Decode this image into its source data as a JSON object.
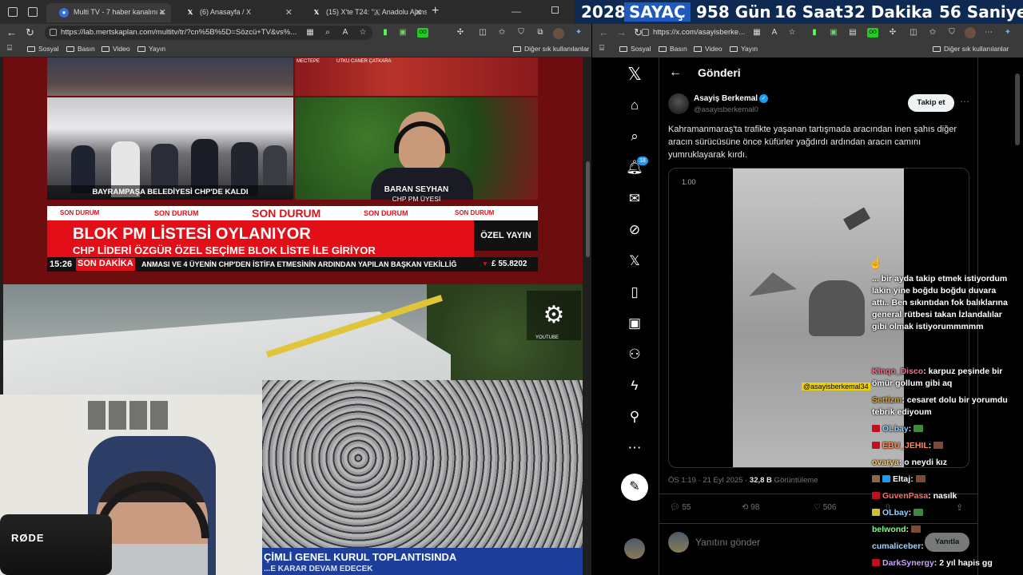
{
  "left_browser": {
    "tabs": [
      {
        "title": "Multi TV - 7 haber kanalını a"
      },
      {
        "title": "(6) Anasayfa / X"
      },
      {
        "title": "(15) X'te T24: \"🇦 Anadolu Ajansı"
      }
    ],
    "url": "https://lab.mertskaplan.com/multitv/tr/?cn%5B%5D=Sözcü+TV&vs%...",
    "bookmarks": [
      "Sosyal",
      "Basın",
      "Video",
      "Yayın"
    ],
    "other_bookmarks": "Diğer sık kullanılanlar"
  },
  "tv": {
    "caption_left": "BAYRAMPAŞA BELEDİYESİ CHP'DE KALDI",
    "guest_name": "BARAN SEYHAN",
    "guest_title": "CHP PM ÜYESİ",
    "son_durum": "SON DURUM",
    "headline": "BLOK PM LİSTESİ OYLANIYOR",
    "subheadline": "CHP LİDERİ ÖZGÜR ÖZEL SEÇİME BLOK LİSTE İLE GİRİYOR",
    "ozel_yayin": "ÖZEL YAYIN",
    "time": "15:26",
    "son_dakika": "SON DAKİKA",
    "ticker": "ANMASI VE 4 ÜYENİN CHP'DEN İSTİFA ETMESİNİN ARDINDAN YAPILAN BAŞKAN VEKİLLİĞ",
    "currency": "£ 55.8202",
    "stand_label_1": "UTKU CANER ÇATKARA",
    "stand_label_2": "MECTEPE"
  },
  "live": {
    "lower_third": "ÇİMLİ GENEL KURUL TOPLANTISINDA",
    "lower_third_2": "...E KARAR DEVAM EDECEK",
    "corner_text": "YOUTUBE"
  },
  "webcam": {
    "mic_brand": "RØDE"
  },
  "countdown": {
    "year": "2028",
    "label": "SAYAÇ",
    "days": "958 Gün",
    "hours": "16 Saat",
    "minutes": "32 Dakika",
    "seconds": "56 Saniye"
  },
  "right_browser": {
    "url": "https://x.com/asayisberke...",
    "bookmarks": [
      "Sosyal",
      "Basın",
      "Video",
      "Yayın"
    ],
    "other_bookmarks": "Diğer sık kullanılanlar"
  },
  "x": {
    "header_title": "Gönderi",
    "notif_count": "18",
    "author_name": "Asayiş Berkemal",
    "author_handle": "@asayisberkemal0",
    "follow_label": "Takip et",
    "post_text": "Kahramanmaraş'ta trafikte yaşanan tartışmada aracından inen şahıs diğer aracın sürücüsüne önce küfürler yağdırdı ardından aracın camını yumruklayarak kırdı.",
    "video_speed": "1.00",
    "video_watermark": "@asayisberkemal34",
    "timestamp": "ÖS 1:19 · 21 Eyl 2025 · ",
    "views": "32,8 B",
    "views_label": " Görüntüleme",
    "replies": "55",
    "reposts": "98",
    "likes": "506",
    "reply_placeholder": "Yanıtını gönder",
    "reply_button": "Yanıtla"
  },
  "chat": [
    {
      "user": "",
      "msg": "... bir ayda takip etmek istiyordum lakin yine boğdu boğdu duvara attı.. Ben sıkıntıdan fok balıklarına general rütbesi takan İzlandalılar gibi olmak istiyorummmmm",
      "color": "#ffffff"
    },
    {
      "user": "Kinqo_Disco",
      "msg": "karpuz peşinde bir ömür gollum gibi aq",
      "color": "#ff6b8b"
    },
    {
      "user": "Settizm",
      "msg": "cesaret dolu bir yorumdu tebrik ediyoum",
      "color": "#d4a838"
    },
    {
      "user": "OLbay",
      "msg": "",
      "color": "#8fd0ff"
    },
    {
      "user": "EBU_JEHIL",
      "msg": "",
      "color": "#ff8c5a"
    },
    {
      "user": "ovarya",
      "msg": "o neydi kız",
      "color": "#ffcc66"
    },
    {
      "user": "Eltaj",
      "msg": "",
      "color": "#ffffff"
    },
    {
      "user": "GuvenPasa",
      "msg": "nasılk",
      "color": "#ff6b6b"
    },
    {
      "user": "OLbay",
      "msg": "",
      "color": "#8fd0ff"
    },
    {
      "user": "belwond",
      "msg": "",
      "color": "#7dff7d"
    },
    {
      "user": "cumaliceber",
      "msg": "",
      "color": "#9fd4ff"
    },
    {
      "user": "DarkSynergy",
      "msg": "2 yıl hapis gg",
      "color": "#c9a0ff"
    }
  ],
  "colors": {
    "x_blue": "#1d9bf0",
    "tv_red": "#e20f18",
    "countdown_bg": "#0f2a52"
  }
}
